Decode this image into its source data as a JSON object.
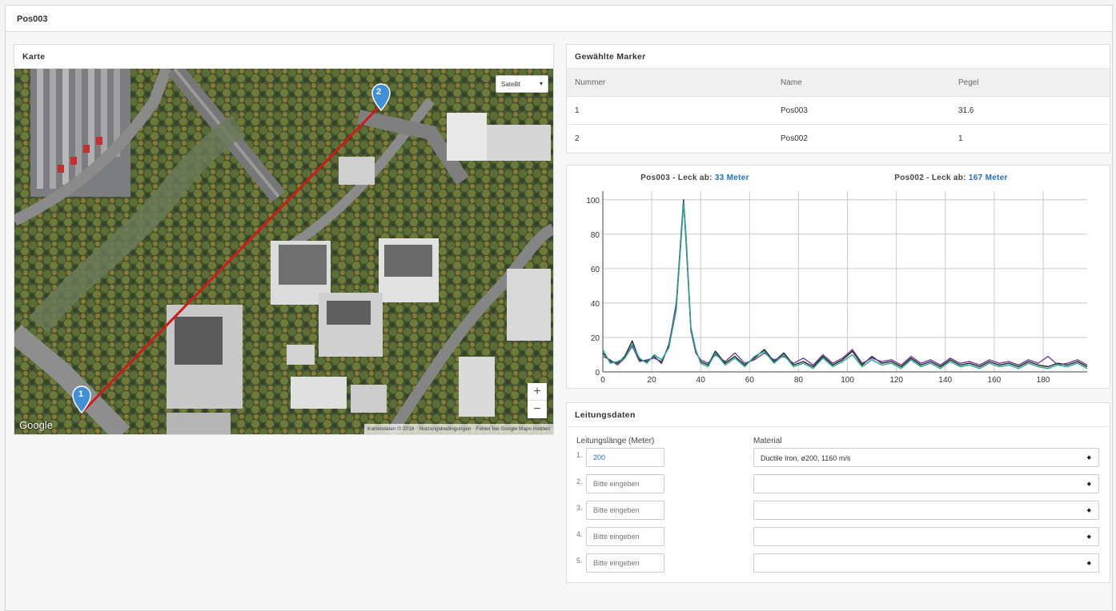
{
  "page": {
    "title": "Pos003"
  },
  "map": {
    "title": "Karte",
    "map_type": "Satellit",
    "zoom_in": "+",
    "zoom_out": "−",
    "logo": "Google",
    "footer": [
      "Kartendaten © 2016",
      "Nutzungsbedingungen",
      "Fehler bei Google Maps melden"
    ],
    "markers": [
      "1",
      "2"
    ],
    "line_color": "#d11a1a",
    "marker_color": "#3f90d4"
  },
  "markers_table": {
    "title": "Gewählte Marker",
    "headers": [
      "Nummer",
      "Name",
      "Pegel"
    ],
    "rows": [
      [
        "1",
        "Pos003",
        "31.6"
      ],
      [
        "2",
        "Pos002",
        "1"
      ]
    ]
  },
  "chart_data": {
    "type": "line",
    "annotations": [
      {
        "prefix": "Pos003 - Leck ab: ",
        "value": "33 Meter"
      },
      {
        "prefix": "Pos002 - Leck ab: ",
        "value": "167 Meter"
      }
    ],
    "xlim": [
      0,
      198
    ],
    "ylim": [
      0,
      105
    ],
    "xticks": [
      "0",
      "20",
      "40",
      "60",
      "80",
      "100",
      "120",
      "140",
      "160",
      "180"
    ],
    "yticks": [
      "0",
      "20",
      "40",
      "60",
      "80",
      "100"
    ],
    "grid": true,
    "series": [
      {
        "color": "#222222",
        "x": [
          0,
          3,
          6,
          9,
          12,
          15,
          18,
          21,
          24,
          27,
          30,
          32,
          33,
          34,
          36,
          38,
          40,
          43,
          46,
          50,
          54,
          58,
          62,
          66,
          70,
          74,
          78,
          82,
          86,
          90,
          94,
          98,
          102,
          106,
          110,
          114,
          118,
          122,
          126,
          130,
          134,
          138,
          142,
          146,
          150,
          154,
          158,
          162,
          166,
          170,
          174,
          178,
          182,
          186,
          190,
          194,
          198
        ],
        "y": [
          11,
          6,
          5,
          9,
          18,
          7,
          6,
          9,
          5,
          16,
          38,
          80,
          100,
          78,
          25,
          12,
          6,
          4,
          12,
          5,
          9,
          4,
          8,
          13,
          6,
          11,
          4,
          6,
          3,
          9,
          4,
          7,
          12,
          4,
          9,
          5,
          6,
          3,
          8,
          4,
          6,
          3,
          7,
          4,
          5,
          3,
          6,
          4,
          5,
          3,
          6,
          4,
          3,
          5,
          4,
          6,
          3
        ]
      },
      {
        "color": "#6b3fa0",
        "x": [
          0,
          3,
          6,
          9,
          12,
          15,
          18,
          21,
          24,
          27,
          30,
          32,
          33,
          34,
          36,
          38,
          40,
          43,
          46,
          50,
          54,
          58,
          62,
          66,
          70,
          74,
          78,
          82,
          86,
          90,
          94,
          98,
          102,
          106,
          110,
          114,
          118,
          122,
          126,
          130,
          134,
          138,
          142,
          146,
          150,
          154,
          158,
          162,
          166,
          170,
          174,
          178,
          182,
          186,
          190,
          194,
          198
        ],
        "y": [
          9,
          7,
          4,
          8,
          15,
          6,
          7,
          8,
          6,
          15,
          40,
          78,
          99,
          76,
          24,
          11,
          7,
          5,
          10,
          6,
          11,
          5,
          7,
          11,
          7,
          9,
          5,
          8,
          4,
          10,
          5,
          8,
          13,
          5,
          8,
          6,
          7,
          4,
          9,
          5,
          7,
          4,
          8,
          5,
          6,
          4,
          7,
          5,
          6,
          4,
          7,
          5,
          9,
          4,
          5,
          7,
          4
        ]
      },
      {
        "color": "#22a98b",
        "x": [
          0,
          3,
          6,
          9,
          12,
          15,
          18,
          21,
          24,
          27,
          30,
          32,
          33,
          34,
          36,
          38,
          40,
          43,
          46,
          50,
          54,
          58,
          62,
          66,
          70,
          74,
          78,
          82,
          86,
          90,
          94,
          98,
          102,
          106,
          110,
          114,
          118,
          122,
          126,
          130,
          134,
          138,
          142,
          146,
          150,
          154,
          158,
          162,
          166,
          170,
          174,
          178,
          182,
          186,
          190,
          194,
          198
        ],
        "y": [
          13,
          5,
          6,
          8,
          16,
          8,
          5,
          10,
          7,
          14,
          36,
          77,
          98,
          80,
          26,
          13,
          5,
          3,
          11,
          4,
          8,
          3,
          9,
          12,
          5,
          10,
          3,
          5,
          2,
          8,
          3,
          6,
          10,
          3,
          7,
          4,
          5,
          2,
          7,
          3,
          5,
          2,
          6,
          3,
          4,
          2,
          5,
          3,
          4,
          2,
          5,
          3,
          2,
          4,
          3,
          5,
          2
        ]
      }
    ]
  },
  "pipe": {
    "title": "Leitungsdaten",
    "length_header": "Leitungslänge (Meter)",
    "material_header": "Material",
    "placeholder": "Bitte eingeben",
    "rows": [
      {
        "num": "1.",
        "length": "200",
        "material": "Ductile Iron, ø200, 1160 m/s"
      },
      {
        "num": "2.",
        "length": "",
        "material": ""
      },
      {
        "num": "3.",
        "length": "",
        "material": ""
      },
      {
        "num": "4.",
        "length": "",
        "material": ""
      },
      {
        "num": "5.",
        "length": "",
        "material": ""
      }
    ]
  }
}
